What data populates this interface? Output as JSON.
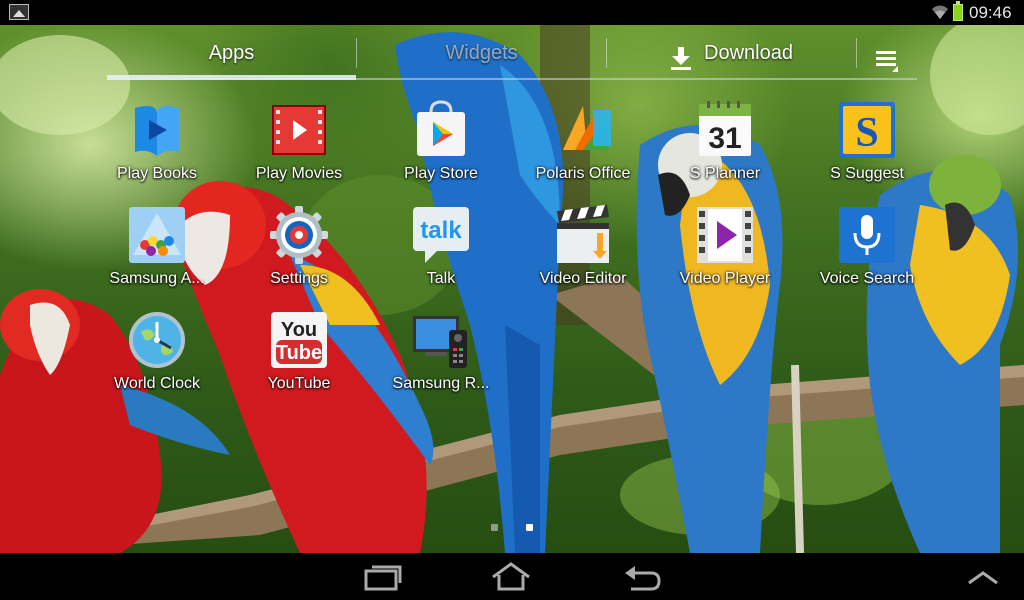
{
  "status_bar": {
    "time": "09:46",
    "icons": [
      "gallery-notification-icon",
      "wifi-icon",
      "battery-icon"
    ],
    "battery_color": "#8ad21e"
  },
  "tabs": {
    "apps": "Apps",
    "widgets": "Widgets",
    "download": "Download",
    "menu_icon": "overflow-menu-icon",
    "selected": "apps"
  },
  "apps": [
    {
      "label": "Play Books",
      "icon": "play-books-icon"
    },
    {
      "label": "Play Movies",
      "icon": "play-movies-icon"
    },
    {
      "label": "Play Store",
      "icon": "play-store-icon"
    },
    {
      "label": "Polaris Office",
      "icon": "polaris-office-icon"
    },
    {
      "label": "S Planner",
      "icon": "s-planner-icon",
      "badge": "31"
    },
    {
      "label": "S Suggest",
      "icon": "s-suggest-icon",
      "badge": "S"
    },
    {
      "label": "Samsung A...",
      "icon": "samsung-apps-icon"
    },
    {
      "label": "Settings",
      "icon": "settings-gear-icon"
    },
    {
      "label": "Talk",
      "icon": "talk-icon",
      "badge": "talk"
    },
    {
      "label": "Video Editor",
      "icon": "video-editor-icon"
    },
    {
      "label": "Video Player",
      "icon": "video-player-icon"
    },
    {
      "label": "Voice Search",
      "icon": "voice-search-microphone-icon"
    },
    {
      "label": "World Clock",
      "icon": "world-clock-icon"
    },
    {
      "label": "YouTube",
      "icon": "youtube-icon",
      "badge": [
        "You",
        "Tube"
      ]
    },
    {
      "label": "Samsung R...",
      "icon": "samsung-remote-icon"
    }
  ],
  "pager": {
    "pages": 2,
    "current": 2
  },
  "nav_bar": {
    "icons": [
      "recent-apps-icon",
      "home-icon",
      "back-icon",
      "expand-up-icon"
    ]
  },
  "colors": {
    "tab_indicator": "#e6f0f5",
    "status_bar_bg": "#000000",
    "nav_bar_bg": "#000000"
  }
}
